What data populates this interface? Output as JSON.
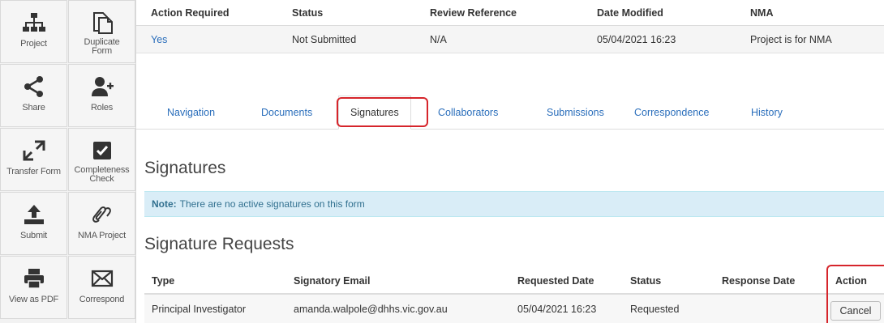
{
  "sidebar": {
    "tiles": [
      {
        "label": "Project",
        "icon": "project-icon"
      },
      {
        "label": "Duplicate Form",
        "icon": "duplicate-icon"
      },
      {
        "label": "Share",
        "icon": "share-icon"
      },
      {
        "label": "Roles",
        "icon": "roles-icon"
      },
      {
        "label": "Transfer Form",
        "icon": "transfer-icon"
      },
      {
        "label": "Completeness Check",
        "icon": "checkbox-icon"
      },
      {
        "label": "Submit",
        "icon": "upload-icon"
      },
      {
        "label": "NMA Project",
        "icon": "nma-icon"
      },
      {
        "label": "View as PDF",
        "icon": "printer-icon"
      },
      {
        "label": "Correspond",
        "icon": "envelope-icon"
      }
    ]
  },
  "info": {
    "headers": {
      "action_required": "Action Required",
      "status": "Status",
      "review_reference": "Review Reference",
      "date_modified": "Date Modified",
      "nma": "NMA"
    },
    "values": {
      "action_required": "Yes",
      "status": "Not Submitted",
      "review_reference": "N/A",
      "date_modified": "05/04/2021 16:23",
      "nma": "Project is for NMA"
    }
  },
  "tabs": {
    "navigation": "Navigation",
    "documents": "Documents",
    "signatures": "Signatures",
    "collaborators": "Collaborators",
    "submissions": "Submissions",
    "correspondence": "Correspondence",
    "history": "History"
  },
  "signatures": {
    "title": "Signatures",
    "note_label": "Note:",
    "note_text": "There are no active signatures on this form"
  },
  "requests": {
    "title": "Signature Requests",
    "columns": {
      "type": "Type",
      "email": "Signatory Email",
      "requested_date": "Requested Date",
      "status": "Status",
      "response_date": "Response Date",
      "action": "Action"
    },
    "rows": [
      {
        "type": "Principal Investigator",
        "email": "amanda.walpole@dhhs.vic.gov.au",
        "requested_date": "05/04/2021 16:23",
        "status": "Requested",
        "response_date": "",
        "action_label": "Cancel"
      }
    ]
  },
  "colors": {
    "link": "#2a6ebb",
    "highlight": "#d6252b",
    "note_bg": "#d9edf7"
  }
}
